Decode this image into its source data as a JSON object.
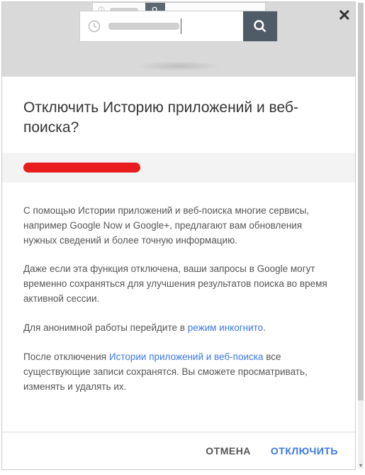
{
  "dialog": {
    "title": "Отключить Историю приложений и веб-поиска?",
    "paragraphs": {
      "p1": "С помощью Истории приложений и веб-поиска многие сервисы, например Google Now и Google+, предлагают вам обновления нужных сведений и более точную информацию.",
      "p2": "Даже если эта функция отключена, ваши запросы в Google могут временно сохраняться для улучшения результатов поиска во время активной сессии.",
      "p3_prefix": "Для анонимной работы перейдите в ",
      "p3_link": "режим инкогнито",
      "p3_suffix": ".",
      "p4_prefix": "После отключения ",
      "p4_link": "Истории приложений и веб-поиска",
      "p4_suffix": " все существующие записи сохранятся. Вы сможете просматривать, изменять и удалять их."
    },
    "buttons": {
      "cancel": "ОТМЕНА",
      "confirm": "ОТКЛЮЧИТЬ"
    }
  }
}
